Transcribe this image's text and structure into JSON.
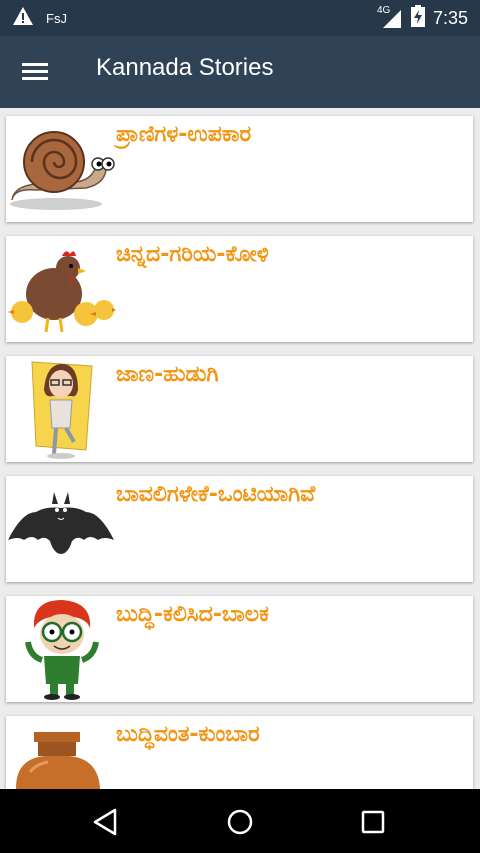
{
  "status_bar": {
    "notification_text": "FsJ",
    "network": "4G",
    "time": "7:35"
  },
  "app_bar": {
    "title": "Kannada Stories"
  },
  "stories": [
    {
      "title": "ಪ್ರಾಣಿಗಳ-ಉಪಕಾರ",
      "image": "snail"
    },
    {
      "title": "ಚಿನ್ನದ-ಗರಿಯ-ಕೋಳಿ",
      "image": "hen-with-chicks"
    },
    {
      "title": "ಜಾಣ-ಹುಡುಗಿ",
      "image": "girl"
    },
    {
      "title": "ಬಾವಲಿಗಳೇಕೆ-ಒಂಟಿಯಾಗಿವೆ",
      "image": "bat"
    },
    {
      "title": "ಬುದ್ಧಿ-ಕಲಿಸಿದ-ಬಾಲಕ",
      "image": "boy"
    },
    {
      "title": "ಬುದ್ಧಿವಂತ-ಕುಂಬಾರ",
      "image": "pot"
    }
  ],
  "colors": {
    "status_bar": "#27384a",
    "app_bar": "#2f4256",
    "title_text": "#f29512",
    "background": "#ececec"
  },
  "nav": {
    "back_icon": "back-triangle",
    "home_icon": "home-circle",
    "recents_icon": "recents-square"
  }
}
